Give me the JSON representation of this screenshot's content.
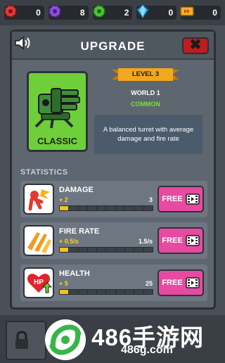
{
  "resources": [
    {
      "name": "red-gear",
      "color": "#e03b3b",
      "value": "0"
    },
    {
      "name": "purple-gear",
      "color": "#8e4fd8",
      "value": "8"
    },
    {
      "name": "green-gear",
      "color": "#4fc23a",
      "value": "2"
    },
    {
      "name": "blue-gem",
      "color": "#3fb3e8",
      "value": "0"
    },
    {
      "name": "yellow-ticket",
      "color": "#f0b323",
      "value": "0"
    }
  ],
  "modal": {
    "title": "UPGRADE",
    "close_label": "✖"
  },
  "turret": {
    "name": "CLASSIC",
    "level": "LEVEL 3",
    "world": "WORLD 1",
    "rarity": "COMMON",
    "description": "A balanced turret with average damage and fire rate",
    "card_color": "#6fcf3a"
  },
  "stats_label": "STATISTICS",
  "stats": [
    {
      "name": "DAMAGE",
      "increment": "+ 2",
      "value": "3",
      "level": 1,
      "segments": 10,
      "button": "FREE"
    },
    {
      "name": "FIRE RATE",
      "increment": "+ 0.5/s",
      "value": "1.5/s",
      "level": 1,
      "segments": 10,
      "button": "FREE"
    },
    {
      "name": "HEALTH",
      "increment": "+ 5",
      "value": "25",
      "level": 1,
      "segments": 10,
      "button": "FREE"
    }
  ],
  "watermark": {
    "text": "486手游网",
    "url": "486g.com"
  },
  "colors": {
    "accent_pink": "#e64aa1",
    "bar_fill": "#f2c21e",
    "rarity": "#74e33b",
    "ribbon": "#f2a81d"
  }
}
